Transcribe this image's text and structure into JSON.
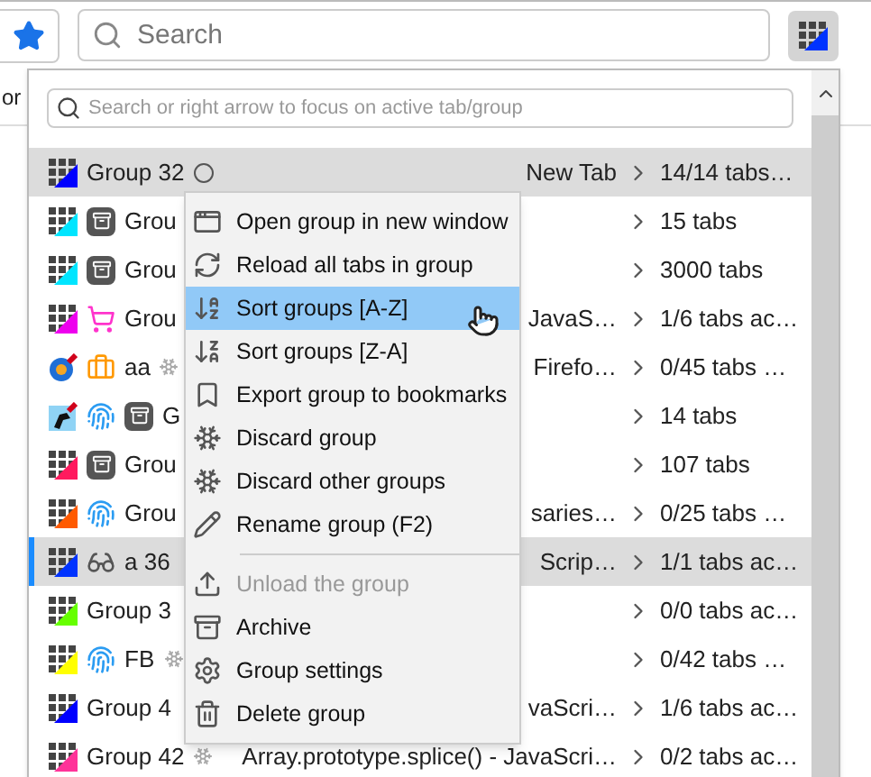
{
  "toolbar": {
    "search": {
      "placeholder": "Search"
    }
  },
  "bookmarks_bar": {
    "text": "or"
  },
  "popup": {
    "search": {
      "placeholder": "Search or right arrow to focus on active tab/group"
    },
    "groups": [
      {
        "color": "#0000ff",
        "name": "Group 32",
        "tab_title": "New Tab",
        "count": "14/14 tabs…",
        "selected": true,
        "current": false
      },
      {
        "color": "#00e5ff",
        "name": "Grou",
        "count": "15 tabs",
        "selected": false,
        "current": false
      },
      {
        "color": "#00e5ff",
        "name": "Grou",
        "count": "3000 tabs",
        "selected": false,
        "current": false
      },
      {
        "color": "#ee00ee",
        "name": "Grou",
        "tab_title": "JavaS…",
        "count": "1/6 tabs ac…",
        "selected": false,
        "current": false
      },
      {
        "color": "#1f6fd6",
        "name": "aa",
        "tab_title": "Firefo…",
        "count": "0/45 tabs …",
        "selected": false,
        "current": false
      },
      {
        "color": "#8fd3f5",
        "name": "G",
        "count": "14 tabs",
        "selected": false,
        "current": false
      },
      {
        "color": "#ff1a5e",
        "name": "Grou",
        "count": "107 tabs",
        "selected": false,
        "current": false
      },
      {
        "color": "#ff5a00",
        "name": "Grou",
        "tab_title": "saries…",
        "count": "0/25 tabs …",
        "selected": false,
        "current": false
      },
      {
        "color": "#0033ff",
        "name": "a 36",
        "tab_title": "Scrip…",
        "count": "1/1 tabs ac…",
        "selected": true,
        "current": true
      },
      {
        "color": "#66ff00",
        "name": "Group 3",
        "count": "0/0 tabs ac…",
        "selected": false,
        "current": false
      },
      {
        "color": "#ffff00",
        "name": "FB",
        "count": "0/42 tabs …",
        "selected": false,
        "current": false
      },
      {
        "color": "#0000ff",
        "name": "Group 4",
        "tab_title": "vaScri…",
        "count": "1/6 tabs ac…",
        "selected": false,
        "current": false
      },
      {
        "color": "#ff3399",
        "name": "Group 42",
        "tab_title": "Array.prototype.splice() - JavaScri…",
        "count": "0/2 tabs ac…",
        "selected": false,
        "current": false
      }
    ]
  },
  "context_menu": {
    "items": [
      {
        "kind": "item",
        "label": "Open group in new window",
        "selected": false,
        "disabled": false
      },
      {
        "kind": "item",
        "label": "Reload all tabs in group",
        "selected": false,
        "disabled": false
      },
      {
        "kind": "item",
        "label": "Sort groups [A-Z]",
        "selected": true,
        "disabled": false
      },
      {
        "kind": "item",
        "label": "Sort groups [Z-A]",
        "selected": false,
        "disabled": false
      },
      {
        "kind": "item",
        "label": "Export group to bookmarks",
        "selected": false,
        "disabled": false
      },
      {
        "kind": "item",
        "label": "Discard group",
        "selected": false,
        "disabled": false
      },
      {
        "kind": "item",
        "label": "Discard other groups",
        "selected": false,
        "disabled": false
      },
      {
        "kind": "item",
        "label": "Rename group (F2)",
        "selected": false,
        "disabled": false
      },
      {
        "kind": "separator"
      },
      {
        "kind": "item",
        "label": "Unload the group",
        "selected": false,
        "disabled": true
      },
      {
        "kind": "item",
        "label": "Archive",
        "selected": false,
        "disabled": false
      },
      {
        "kind": "item",
        "label": "Group settings",
        "selected": false,
        "disabled": false
      },
      {
        "kind": "item",
        "label": "Delete group",
        "selected": false,
        "disabled": false
      }
    ]
  }
}
